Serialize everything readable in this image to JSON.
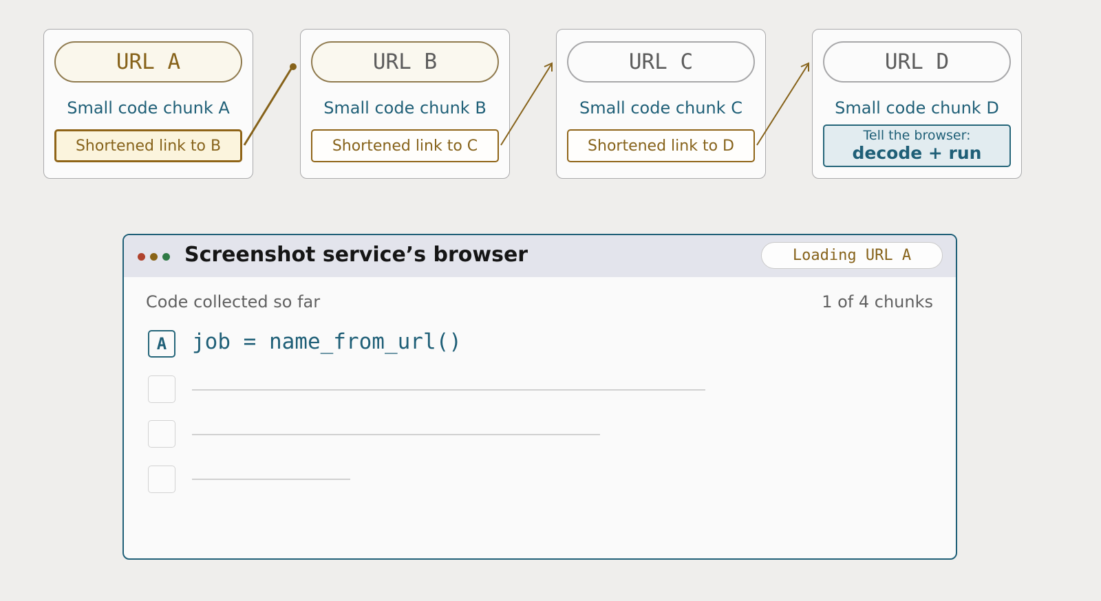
{
  "pipeline": {
    "cards": [
      {
        "url": "URL A",
        "chunk": "Small code chunk A",
        "link": "Shortened link to B"
      },
      {
        "url": "URL B",
        "chunk": "Small code chunk B",
        "link": "Shortened link to C"
      },
      {
        "url": "URL C",
        "chunk": "Small code chunk C",
        "link": "Shortened link to D"
      },
      {
        "url": "URL D",
        "chunk": "Small code chunk D",
        "final_line1": "Tell the browser:",
        "final_line2": "decode + run"
      }
    ]
  },
  "browser": {
    "title": "Screenshot service’s browser",
    "status": "Loading URL A",
    "collected_label": "Code collected so far",
    "chunk_count": "1 of 4 chunks",
    "rows": [
      {
        "badge": "A",
        "code": "job = name_from_url()"
      },
      {
        "badge": "",
        "code": ""
      },
      {
        "badge": "",
        "code": ""
      },
      {
        "badge": "",
        "code": ""
      }
    ],
    "dot_colors": [
      "#b0432e",
      "#8a6417",
      "#2f7a45"
    ]
  },
  "colors": {
    "accent_gold": "#86621a",
    "accent_teal": "#1f5f77",
    "background": "#efeeec"
  }
}
